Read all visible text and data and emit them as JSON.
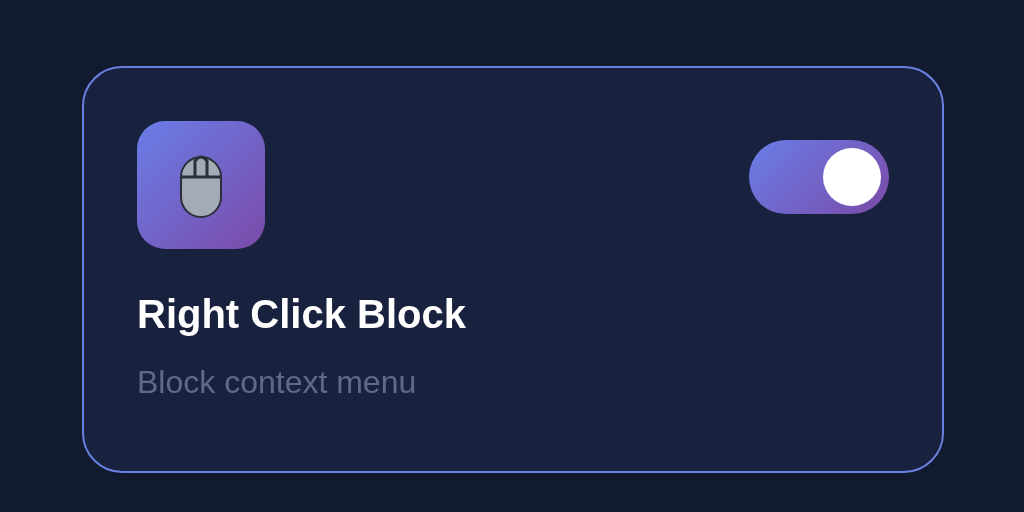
{
  "card": {
    "title": "Right Click Block",
    "description": "Block context menu",
    "toggle": {
      "on": true
    }
  }
}
